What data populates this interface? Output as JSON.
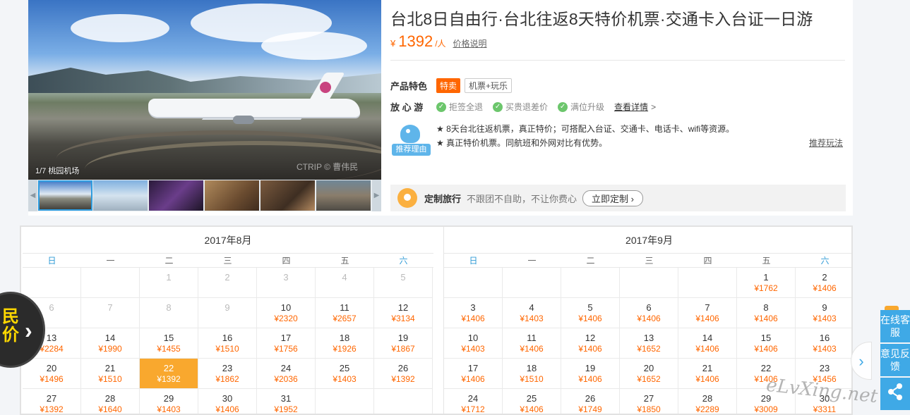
{
  "product": {
    "title": "台北8日自由行·台北往返8天特价机票·交通卡入台证一日游",
    "price_currency": "¥",
    "price_value": "1392",
    "price_unit": "/人",
    "price_note": "价格说明"
  },
  "gallery": {
    "caption": "1/7 桃园机场",
    "watermark": "CTRIP © 曹伟民",
    "thumb_colors": [
      "#5a7fa6",
      "#8aa6c2",
      "#4b2d5e",
      "#8a6a47",
      "#5a4634",
      "#6b7a86"
    ]
  },
  "features": {
    "label": "产品特色",
    "tag1": "特卖",
    "tag2": "机票+玩乐"
  },
  "assurance": {
    "label": "放 心 游",
    "items": [
      "拒签全退",
      "买贵退差价",
      "满位升级"
    ],
    "detail_link": "查看详情",
    "detail_arrow": ">"
  },
  "recommend": {
    "badge": "推荐理由",
    "line1": "★ 8天台北往返机票，真正特价；可搭配入台证、交通卡、电话卡、wifi等资源。",
    "line2": "★ 真正特价机票。同航班和外网对比有优势。",
    "more": "推荐玩法"
  },
  "custom_trip": {
    "title": "定制旅行",
    "text": "不跟团不自助，不让你费心",
    "button": "立即定制 ›"
  },
  "calendar": {
    "weekdays": [
      "日",
      "一",
      "二",
      "三",
      "四",
      "五",
      "六"
    ],
    "months": [
      {
        "title": "2017年8月",
        "cells": [
          {
            "d": "",
            "p": ""
          },
          {
            "d": "",
            "p": ""
          },
          {
            "d": "1",
            "p": "",
            "past": true
          },
          {
            "d": "2",
            "p": "",
            "past": true
          },
          {
            "d": "3",
            "p": "",
            "past": true
          },
          {
            "d": "4",
            "p": "",
            "past": true
          },
          {
            "d": "5",
            "p": "",
            "past": true
          },
          {
            "d": "6",
            "p": "",
            "past": true
          },
          {
            "d": "7",
            "p": "",
            "past": true
          },
          {
            "d": "8",
            "p": "",
            "past": true
          },
          {
            "d": "9",
            "p": "",
            "past": true
          },
          {
            "d": "10",
            "p": "¥2320"
          },
          {
            "d": "11",
            "p": "¥2657"
          },
          {
            "d": "12",
            "p": "¥3134"
          },
          {
            "d": "13",
            "p": "¥2284"
          },
          {
            "d": "14",
            "p": "¥1990"
          },
          {
            "d": "15",
            "p": "¥1455"
          },
          {
            "d": "16",
            "p": "¥1510"
          },
          {
            "d": "17",
            "p": "¥1756"
          },
          {
            "d": "18",
            "p": "¥1926"
          },
          {
            "d": "19",
            "p": "¥1867"
          },
          {
            "d": "20",
            "p": "¥1496"
          },
          {
            "d": "21",
            "p": "¥1510"
          },
          {
            "d": "22",
            "p": "¥1392",
            "sel": true
          },
          {
            "d": "23",
            "p": "¥1862"
          },
          {
            "d": "24",
            "p": "¥2036"
          },
          {
            "d": "25",
            "p": "¥1403"
          },
          {
            "d": "26",
            "p": "¥1392"
          },
          {
            "d": "27",
            "p": "¥1392"
          },
          {
            "d": "28",
            "p": "¥1640"
          },
          {
            "d": "29",
            "p": "¥1403"
          },
          {
            "d": "30",
            "p": "¥1406"
          },
          {
            "d": "31",
            "p": "¥1952"
          },
          {
            "d": "",
            "p": ""
          },
          {
            "d": "",
            "p": ""
          }
        ]
      },
      {
        "title": "2017年9月",
        "cells": [
          {
            "d": "",
            "p": ""
          },
          {
            "d": "",
            "p": ""
          },
          {
            "d": "",
            "p": ""
          },
          {
            "d": "",
            "p": ""
          },
          {
            "d": "",
            "p": ""
          },
          {
            "d": "1",
            "p": "¥1762"
          },
          {
            "d": "2",
            "p": "¥1406"
          },
          {
            "d": "3",
            "p": "¥1406"
          },
          {
            "d": "4",
            "p": "¥1403"
          },
          {
            "d": "5",
            "p": "¥1406"
          },
          {
            "d": "6",
            "p": "¥1406"
          },
          {
            "d": "7",
            "p": "¥1406"
          },
          {
            "d": "8",
            "p": "¥1406"
          },
          {
            "d": "9",
            "p": "¥1403"
          },
          {
            "d": "10",
            "p": "¥1403"
          },
          {
            "d": "11",
            "p": "¥1406"
          },
          {
            "d": "12",
            "p": "¥1406"
          },
          {
            "d": "13",
            "p": "¥1652"
          },
          {
            "d": "14",
            "p": "¥1406"
          },
          {
            "d": "15",
            "p": "¥1406"
          },
          {
            "d": "16",
            "p": "¥1403"
          },
          {
            "d": "17",
            "p": "¥1406"
          },
          {
            "d": "18",
            "p": "¥1510"
          },
          {
            "d": "19",
            "p": "¥1406"
          },
          {
            "d": "20",
            "p": "¥1652"
          },
          {
            "d": "21",
            "p": "¥1406"
          },
          {
            "d": "22",
            "p": "¥1406"
          },
          {
            "d": "23",
            "p": "¥1456"
          },
          {
            "d": "24",
            "p": "¥1712"
          },
          {
            "d": "25",
            "p": "¥1406"
          },
          {
            "d": "26",
            "p": "¥1749"
          },
          {
            "d": "27",
            "p": "¥1850"
          },
          {
            "d": "28",
            "p": "¥2289"
          },
          {
            "d": "29",
            "p": "¥3009"
          },
          {
            "d": "30",
            "p": "¥3311"
          }
        ]
      }
    ]
  },
  "promo": {
    "text": "民价",
    "arrow": "›"
  },
  "side_tools": {
    "online_service": "在线客服",
    "feedback": "意见反馈",
    "share_icon": "share-icon"
  },
  "next_arrow": "›",
  "site_watermark": "eLvXing.net",
  "colors": {
    "accent": "#ff6600",
    "selected_day": "#f9a82e",
    "weekend": "#2e9ad6",
    "side_blue": "#3fa9e6"
  }
}
